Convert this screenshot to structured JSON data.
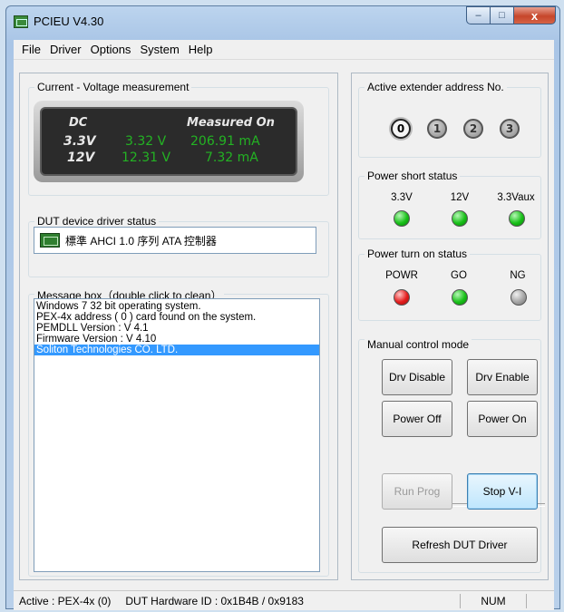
{
  "window": {
    "title": "PCIEU V4.30",
    "minimize": "–",
    "maximize": "□",
    "close": "x"
  },
  "menu": [
    "File",
    "Driver",
    "Options",
    "System",
    "Help"
  ],
  "measurement": {
    "title": "Current - Voltage measurement",
    "header_left": "DC",
    "header_right": "Measured On",
    "rows": [
      {
        "label": "3.3V",
        "voltage": "3.32 V",
        "current": "206.91 mA"
      },
      {
        "label": "12V",
        "voltage": "12.31 V",
        "current": "7.32 mA"
      }
    ]
  },
  "driver_status": {
    "title": "DUT device driver status",
    "icon": "chip-icon",
    "value": "標準 AHCI 1.0 序列 ATA 控制器"
  },
  "messages": {
    "title": "Message box（double click to  clean）",
    "lines": [
      " Windows 7 32 bit operating system.",
      "PEX-4x address ( 0 ) card found on the system.",
      " PEMDLL Version : V 4.1",
      "Firmware Version : V 4.10",
      "Soliton Technologies CO. LTD."
    ],
    "selected_index": 4
  },
  "extender": {
    "title": "Active extender address No.",
    "addresses": [
      "0",
      "1",
      "2",
      "3"
    ],
    "active": 0
  },
  "power_short": {
    "title": "Power short status",
    "items": [
      {
        "label": "3.3V",
        "color": "green"
      },
      {
        "label": "12V",
        "color": "green"
      },
      {
        "label": "3.3Vaux",
        "color": "green"
      }
    ]
  },
  "power_on": {
    "title": "Power turn on status",
    "items": [
      {
        "label": "POWR",
        "color": "red"
      },
      {
        "label": "GO",
        "color": "green"
      },
      {
        "label": "NG",
        "color": "gray"
      }
    ]
  },
  "manual": {
    "title": "Manual control mode",
    "drv_disable": "Drv Disable",
    "drv_enable": "Drv Enable",
    "power_off": "Power Off",
    "power_on": "Power On",
    "run_prog": "Run Prog",
    "stop_vi": "Stop V-I",
    "refresh": "Refresh DUT Driver"
  },
  "status": {
    "active": "Active : PEX-4x (0)",
    "hw_id": "DUT Hardware ID : 0x1B4B  / 0x9183",
    "num": "NUM"
  }
}
